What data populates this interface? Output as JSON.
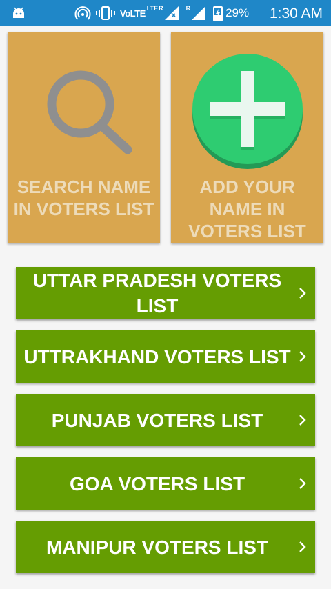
{
  "status_bar": {
    "network_label": "VoLTE",
    "lte_label": "LTE",
    "roaming_label_1": "R",
    "roaming_label_2": "R",
    "battery_percent": "29%",
    "time": "1:30 AM",
    "background_color": "#1f87c8"
  },
  "cards": [
    {
      "label": "SEARCH NAME IN VOTERS LIST",
      "icon": "magnifier-icon"
    },
    {
      "label": "ADD YOUR NAME IN VOTERS LIST",
      "icon": "plus-icon"
    }
  ],
  "state_buttons": [
    {
      "label": "UTTAR PRADESH VOTERS LIST"
    },
    {
      "label": "UTTRAKHAND VOTERS LIST"
    },
    {
      "label": "PUNJAB VOTERS LIST"
    },
    {
      "label": "GOA VOTERS LIST"
    },
    {
      "label": "MANIPUR VOTERS LIST"
    }
  ],
  "colors": {
    "card": "#d9a64f",
    "card_text": "#eddbb9",
    "button": "#659d02",
    "plus_circle": "#2ecc71"
  }
}
